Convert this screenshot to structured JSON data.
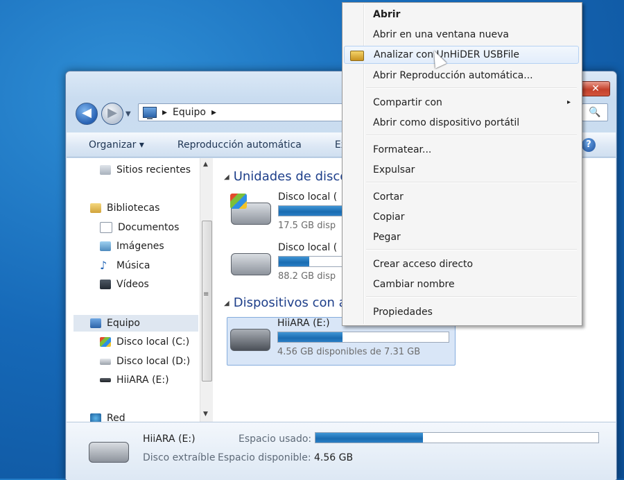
{
  "window": {
    "close_label": "✕",
    "address": {
      "crumb_sep": "▸",
      "location": "Equipo",
      "trail_sep": "▸"
    },
    "search_icon": "🔍",
    "toolbar": {
      "organize": "Organizar ▾",
      "autoplay": "Reproducción automática",
      "eject_partial": "Exp"
    },
    "help_label": "?"
  },
  "nav_pane": {
    "items": [
      {
        "label": "Sitios recientes",
        "icon": "recent-places-icon"
      },
      {
        "label": "Bibliotecas",
        "icon": "libraries-icon"
      },
      {
        "label": "Documentos",
        "icon": "documents-icon"
      },
      {
        "label": "Imágenes",
        "icon": "pictures-icon"
      },
      {
        "label": "Música",
        "icon": "music-icon"
      },
      {
        "label": "Vídeos",
        "icon": "videos-icon"
      },
      {
        "label": "Equipo",
        "icon": "computer-icon"
      },
      {
        "label": "Disco local (C:)",
        "icon": "windows-drive-icon"
      },
      {
        "label": "Disco local (D:)",
        "icon": "drive-icon"
      },
      {
        "label": "HiiARA (E:)",
        "icon": "usb-drive-icon"
      },
      {
        "label": "Red",
        "icon": "network-icon"
      }
    ],
    "scroll_up": "▲",
    "scroll_down": "▼",
    "scroll_grip": "≡"
  },
  "content": {
    "group_hdd": "Unidades de disco",
    "group_removable": "Dispositivos con a",
    "collapse_glyph": "◢",
    "drives": [
      {
        "name": "Disco local (",
        "free": "17.5 GB disp",
        "usage": 0.45
      },
      {
        "name": "Disco local (",
        "free": "88.2 GB disp",
        "usage": 0.18
      },
      {
        "name": "HiiARA (E:)",
        "free": "4.56 GB disponibles de 7.31 GB",
        "usage": 0.38
      }
    ]
  },
  "status": {
    "name": "HiiARA (E:)",
    "type": "Disco extraíble",
    "used_label": "Espacio usado:",
    "free_label": "Espacio disponible:",
    "free_value": "4.56 GB",
    "usage": 0.38
  },
  "context_menu": {
    "items": [
      {
        "label": "Abrir",
        "bold": true
      },
      {
        "label": "Abrir en una ventana nueva"
      },
      {
        "label": "Analizar con UnHiDER USBFile",
        "hover": true,
        "icon": "unhider-icon"
      },
      {
        "label": "Abrir Reproducción automática..."
      },
      {
        "label": "Compartir con",
        "submenu": "▸"
      },
      {
        "label": "Abrir como dispositivo portátil"
      },
      {
        "label": "Formatear..."
      },
      {
        "label": "Expulsar"
      },
      {
        "label": "Cortar"
      },
      {
        "label": "Copiar"
      },
      {
        "label": "Pegar"
      },
      {
        "label": "Crear acceso directo"
      },
      {
        "label": "Cambiar nombre"
      },
      {
        "label": "Propiedades"
      }
    ]
  }
}
